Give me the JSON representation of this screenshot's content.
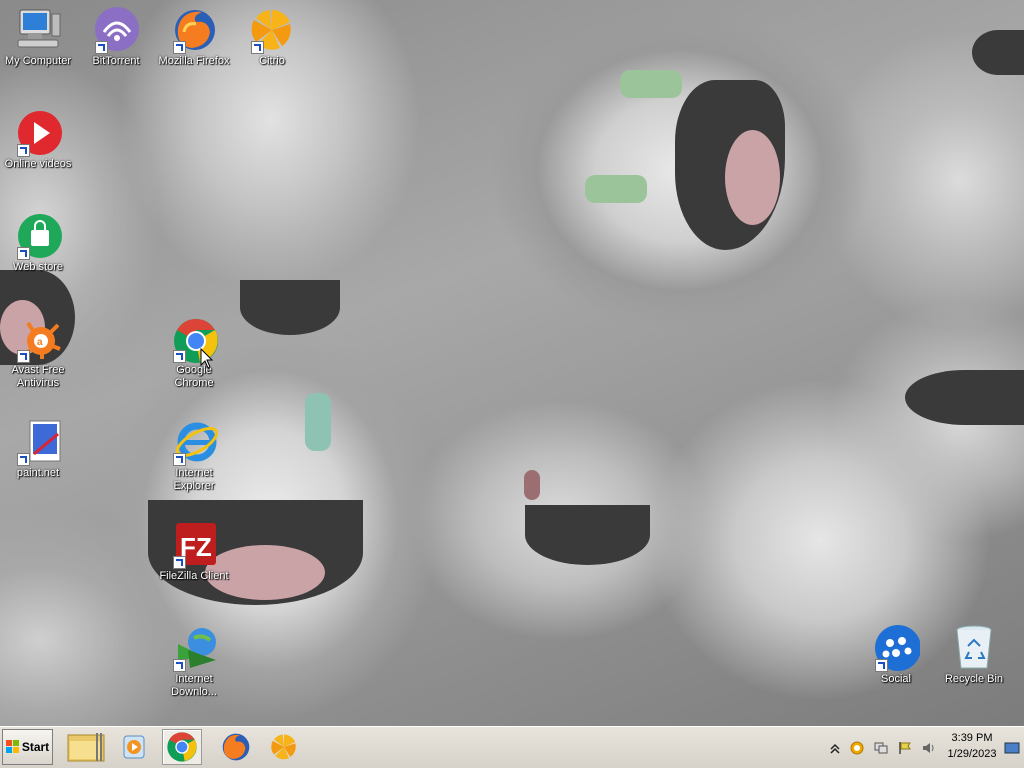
{
  "desktop": {
    "icons": [
      {
        "id": "my-computer",
        "label": "My Computer"
      },
      {
        "id": "bittorrent",
        "label": "BitTorrent"
      },
      {
        "id": "firefox",
        "label": "Mozilla Firefox"
      },
      {
        "id": "citrio",
        "label": "Citrio"
      },
      {
        "id": "online-videos",
        "label": "Online videos"
      },
      {
        "id": "web-store",
        "label": "Web store"
      },
      {
        "id": "avast",
        "label": "Avast Free Antivirus"
      },
      {
        "id": "chrome",
        "label": "Google Chrome"
      },
      {
        "id": "paintnet",
        "label": "paint.net"
      },
      {
        "id": "ie",
        "label": "Internet Explorer"
      },
      {
        "id": "filezilla",
        "label": "FileZilla Client"
      },
      {
        "id": "idm",
        "label": "Internet Downlo..."
      },
      {
        "id": "social",
        "label": "Social"
      },
      {
        "id": "recycle",
        "label": "Recycle Bin"
      }
    ]
  },
  "taskbar": {
    "start_label": "Start",
    "pinned": [
      {
        "name": "windows-explorer-icon"
      },
      {
        "name": "media-player-icon"
      },
      {
        "name": "chrome-icon",
        "active": true
      },
      {
        "name": "firefox-icon"
      },
      {
        "name": "citrio-icon"
      }
    ],
    "clock": {
      "time": "3:39 PM",
      "date": "1/29/2023"
    }
  },
  "colors": {
    "taskbar_bg": "#dcd8d0",
    "chrome_red": "#db4437",
    "chrome_yellow": "#f4c20d",
    "chrome_green": "#0f9d58",
    "chrome_blue": "#4285f4"
  }
}
